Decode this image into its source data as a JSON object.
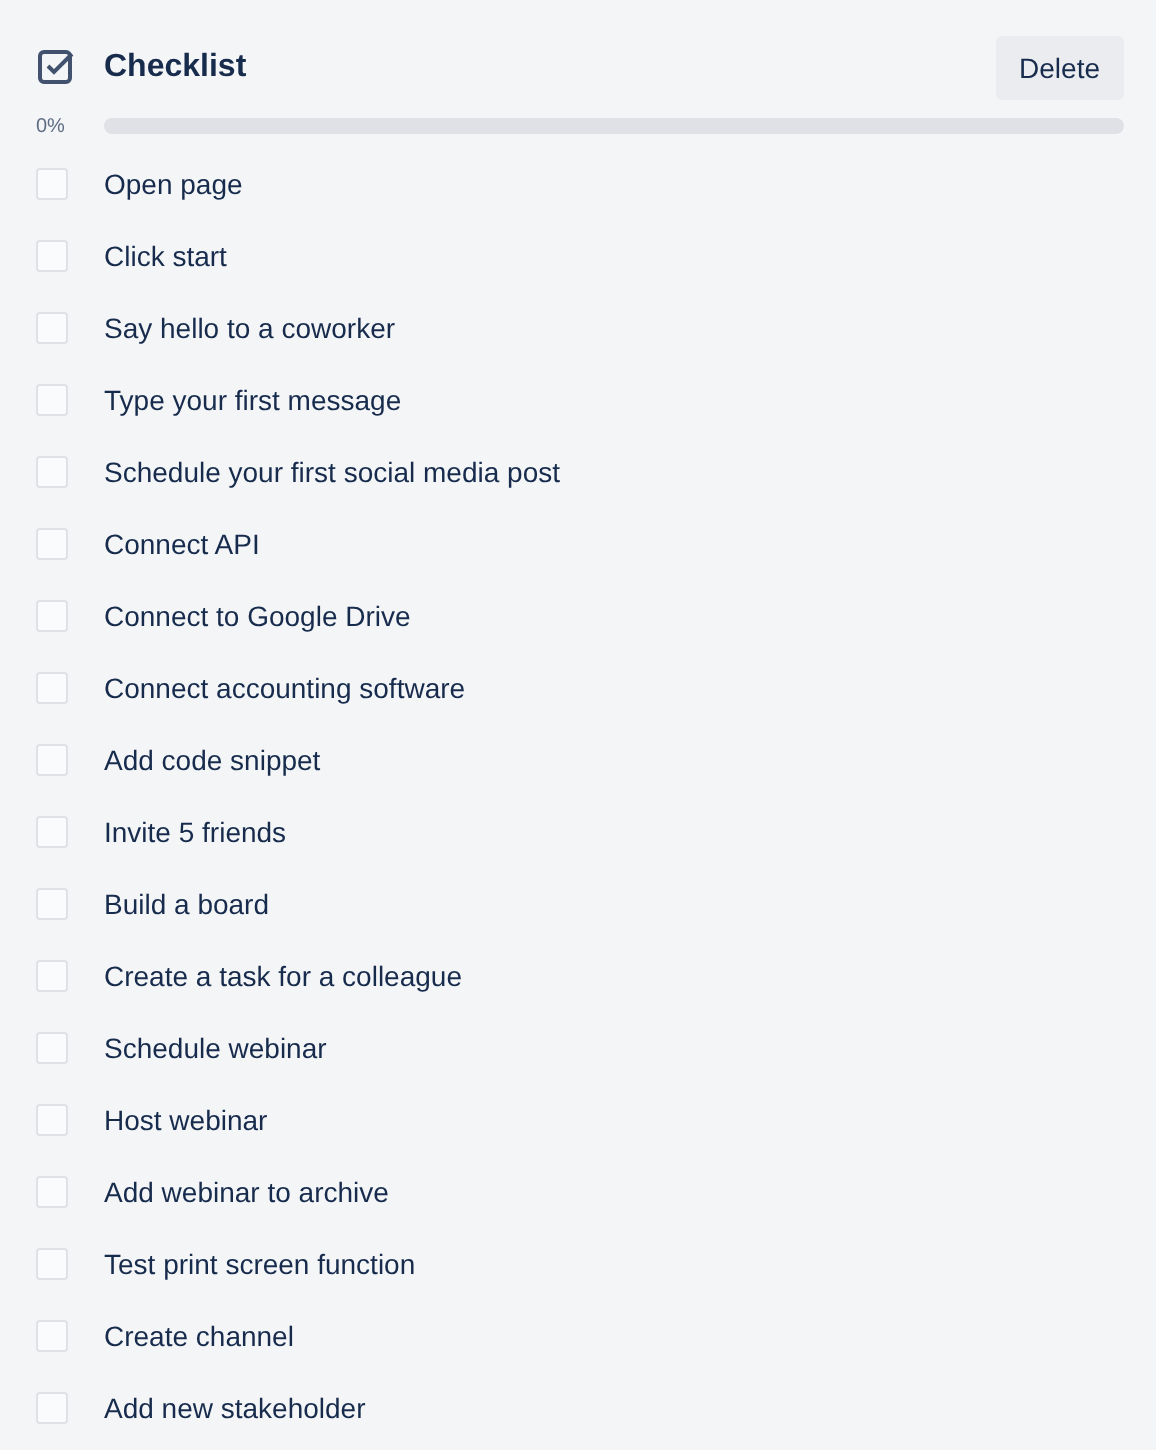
{
  "header": {
    "title": "Checklist",
    "delete_button": "Delete"
  },
  "progress": {
    "label": "0%",
    "level": 0
  },
  "items": [
    {
      "label": "Open page",
      "checked": false
    },
    {
      "label": "Click start",
      "checked": false
    },
    {
      "label": "Say hello to a coworker",
      "checked": false
    },
    {
      "label": "Type your first message",
      "checked": false
    },
    {
      "label": "Schedule your first social media post",
      "checked": false
    },
    {
      "label": "Connect API",
      "checked": false
    },
    {
      "label": "Connect to Google Drive",
      "checked": false
    },
    {
      "label": "Connect accounting software",
      "checked": false
    },
    {
      "label": "Add code snippet",
      "checked": false
    },
    {
      "label": "Invite 5 friends",
      "checked": false
    },
    {
      "label": "Build a board",
      "checked": false
    },
    {
      "label": "Create a task for a colleague",
      "checked": false
    },
    {
      "label": "Schedule webinar",
      "checked": false
    },
    {
      "label": "Host webinar",
      "checked": false
    },
    {
      "label": "Add webinar to archive",
      "checked": false
    },
    {
      "label": "Test print screen function",
      "checked": false
    },
    {
      "label": "Create channel",
      "checked": false
    },
    {
      "label": "Add new stakeholder",
      "checked": false
    }
  ]
}
